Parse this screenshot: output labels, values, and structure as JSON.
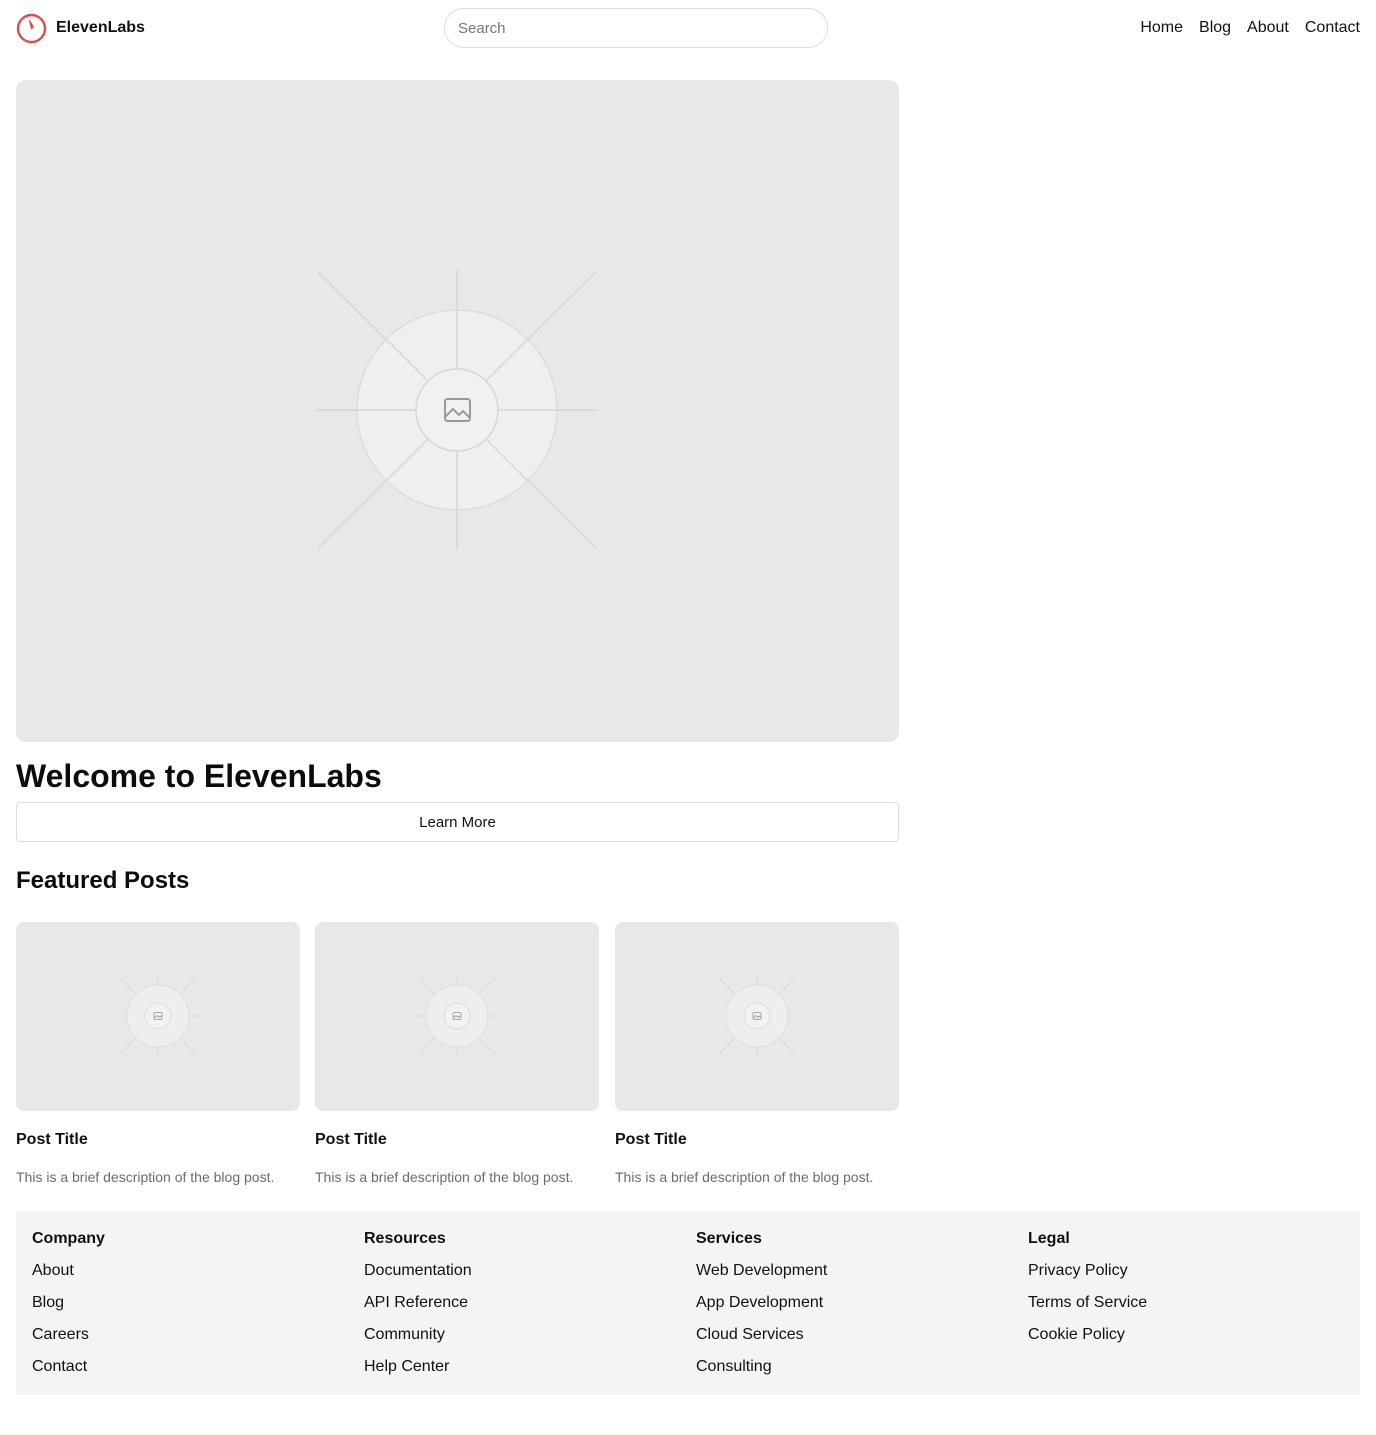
{
  "header": {
    "brand": "ElevenLabs",
    "logo_icon": "clock-logo-icon",
    "accent_color": "#e34a4a",
    "search_placeholder": "Search",
    "nav": [
      "Home",
      "Blog",
      "About",
      "Contact"
    ]
  },
  "hero": {
    "image_icon": "image-placeholder-icon",
    "title": "Welcome to ElevenLabs",
    "button_label": "Learn More"
  },
  "featured": {
    "heading": "Featured Posts",
    "posts": [
      {
        "title": "Post Title",
        "description": "This is a brief description of the blog post."
      },
      {
        "title": "Post Title",
        "description": "This is a brief description of the blog post."
      },
      {
        "title": "Post Title",
        "description": "This is a brief description of the blog post."
      }
    ]
  },
  "footer": {
    "background": "#f3f4f6",
    "columns": [
      {
        "heading": "Company",
        "links": [
          "About",
          "Blog",
          "Careers",
          "Contact"
        ]
      },
      {
        "heading": "Resources",
        "links": [
          "Documentation",
          "API Reference",
          "Community",
          "Help Center"
        ]
      },
      {
        "heading": "Services",
        "links": [
          "Web Development",
          "App Development",
          "Cloud Services",
          "Consulting"
        ]
      },
      {
        "heading": "Legal",
        "links": [
          "Privacy Policy",
          "Terms of Service",
          "Cookie Policy"
        ]
      }
    ]
  }
}
